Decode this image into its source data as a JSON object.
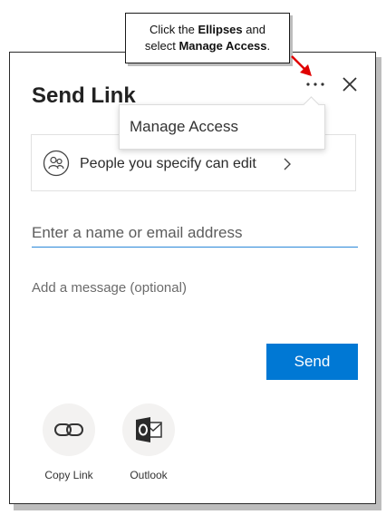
{
  "callout": {
    "line1_prefix": "Click the ",
    "line1_bold": "Ellipses",
    "line1_suffix": " and",
    "line2_prefix": "select ",
    "line2_bold": "Manage Access",
    "line2_suffix": "."
  },
  "dialog": {
    "title": "Send Link",
    "more_icon": "ellipsis-icon",
    "close_icon": "close-icon",
    "menu": {
      "items": [
        {
          "label": "Manage Access"
        }
      ]
    },
    "permission": {
      "icon": "people-icon",
      "label": "People you specify can edit",
      "chevron": "chevron-right-icon"
    },
    "recipient": {
      "placeholder": "Enter a name or email address",
      "value": ""
    },
    "message": {
      "placeholder": "Add a message (optional)",
      "value": ""
    },
    "send_label": "Send",
    "share_options": [
      {
        "label": "Copy Link",
        "icon": "link-icon"
      },
      {
        "label": "Outlook",
        "icon": "outlook-icon"
      }
    ]
  },
  "colors": {
    "primary": "#0078d4",
    "input_focus": "#2b88d8",
    "arrow": "#e00000"
  }
}
